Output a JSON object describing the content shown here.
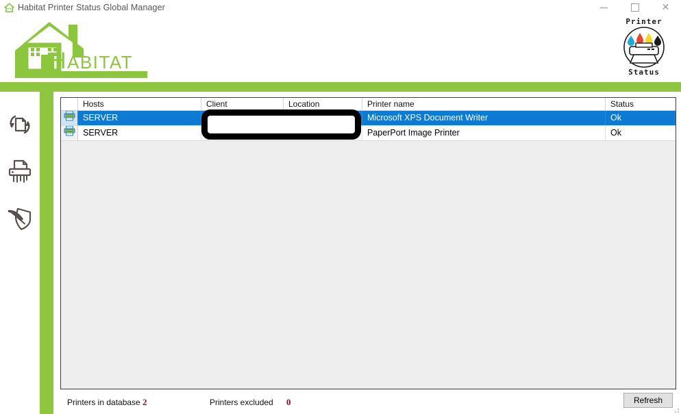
{
  "window": {
    "title": "Habitat Printer Status Global Manager",
    "icon": "house-icon",
    "minimize_label": "",
    "maximize_label": "",
    "close_label": "✕"
  },
  "branding": {
    "habitat_text": "HABITAT",
    "printer_logo_top": "Printer",
    "printer_logo_bottom": "Status",
    "green": "#8fc640"
  },
  "sidebar": {
    "items": [
      {
        "name": "refresh-documents-icon",
        "label": ""
      },
      {
        "name": "shredder-icon",
        "label": ""
      },
      {
        "name": "quill-shield-icon",
        "label": ""
      }
    ]
  },
  "table": {
    "columns": [
      {
        "key": "icon",
        "label": ""
      },
      {
        "key": "hosts",
        "label": "Hosts"
      },
      {
        "key": "client",
        "label": "Client"
      },
      {
        "key": "location",
        "label": "Location"
      },
      {
        "key": "printer",
        "label": "Printer name"
      },
      {
        "key": "status",
        "label": "Status"
      }
    ],
    "rows": [
      {
        "selected": true,
        "icon": "printer-icon",
        "hosts": "SERVER",
        "client": "",
        "location": "",
        "printer": "Microsoft XPS Document Writer",
        "status": "Ok"
      },
      {
        "selected": false,
        "icon": "printer-icon",
        "hosts": "SERVER",
        "client": "",
        "location": "",
        "printer": "PaperPort Image Printer",
        "status": "Ok"
      }
    ]
  },
  "annotation": {
    "name": "highlight-box",
    "shape": "rounded-rectangle",
    "color": "#000000"
  },
  "status_bar": {
    "printers_in_database_label": "Printers in database",
    "printers_in_database_value": "2",
    "printers_excluded_label": "Printers excluded",
    "printers_excluded_value": "0",
    "refresh_label": "Refresh",
    "value_color": "#8b0f18"
  }
}
